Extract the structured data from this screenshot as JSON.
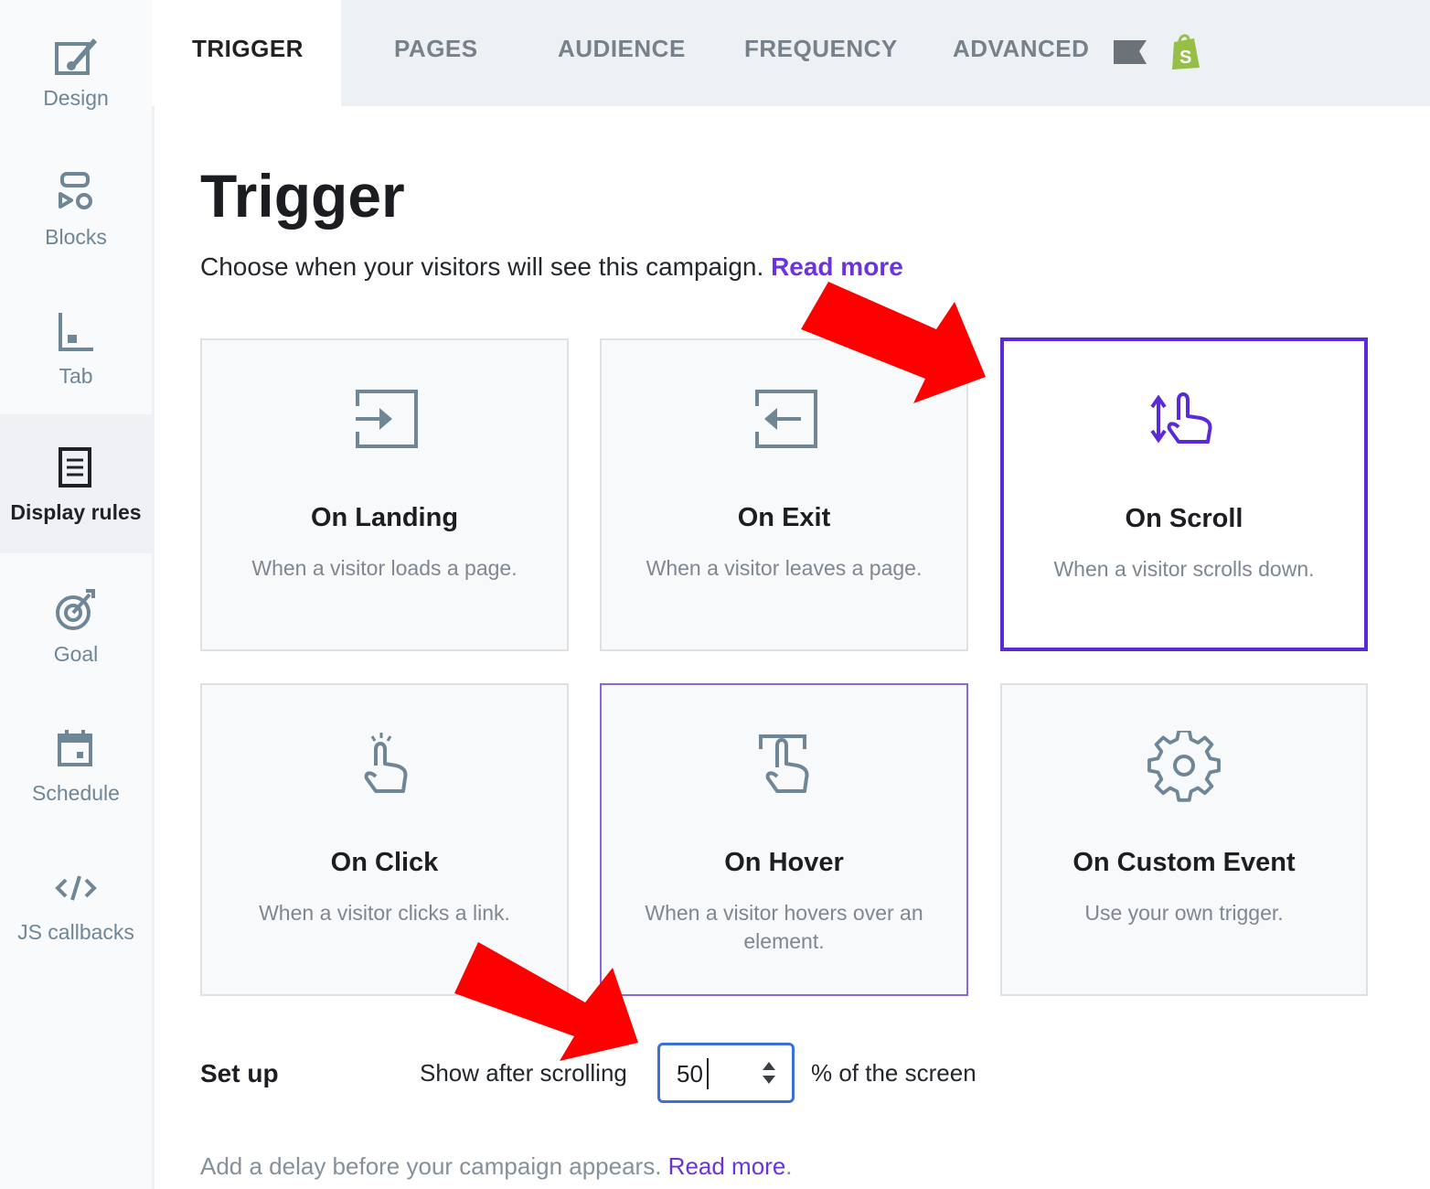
{
  "sidebar": {
    "items": [
      {
        "label": "Design",
        "icon": "design-brush-icon"
      },
      {
        "label": "Blocks",
        "icon": "blocks-icon"
      },
      {
        "label": "Tab",
        "icon": "tab-icon"
      },
      {
        "label": "Display rules",
        "icon": "display-rules-icon",
        "active": true
      },
      {
        "label": "Goal",
        "icon": "goal-target-icon"
      },
      {
        "label": "Schedule",
        "icon": "calendar-icon"
      },
      {
        "label": "JS callbacks",
        "icon": "code-icon"
      }
    ]
  },
  "tabs": [
    "TRIGGER",
    "PAGES",
    "AUDIENCE",
    "FREQUENCY",
    "ADVANCED"
  ],
  "active_tab": "TRIGGER",
  "main": {
    "title": "Trigger",
    "subtitle": "Choose when your visitors will see this campaign.",
    "subtitle_link": "Read more"
  },
  "cards": [
    {
      "title": "On Landing",
      "desc": "When a visitor loads a page.",
      "icon": "enter-icon"
    },
    {
      "title": "On Exit",
      "desc": "When a visitor leaves a page.",
      "icon": "exit-icon"
    },
    {
      "title": "On Scroll",
      "desc": "When a visitor scrolls down.",
      "icon": "scroll-hand-icon",
      "selected": true
    },
    {
      "title": "On Click",
      "desc": "When a visitor clicks a link.",
      "icon": "click-hand-icon"
    },
    {
      "title": "On Hover",
      "desc": "When a visitor hovers over an element.",
      "icon": "hover-hand-icon"
    },
    {
      "title": "On Custom Event",
      "desc": "Use your own trigger.",
      "icon": "gear-icon"
    }
  ],
  "setup": {
    "label": "Set up",
    "prefix": "Show after scrolling",
    "value": "50",
    "suffix": "% of the screen"
  },
  "delay": {
    "text": "Add a delay before your campaign appears.",
    "link": "Read more",
    "after_link": "."
  },
  "colors": {
    "accent": "#6a33dd",
    "selected_border": "#5a2ad8",
    "input_border": "#3d6fd9",
    "annotation_arrow": "#ff0000",
    "shopify_green": "#95bf47"
  }
}
